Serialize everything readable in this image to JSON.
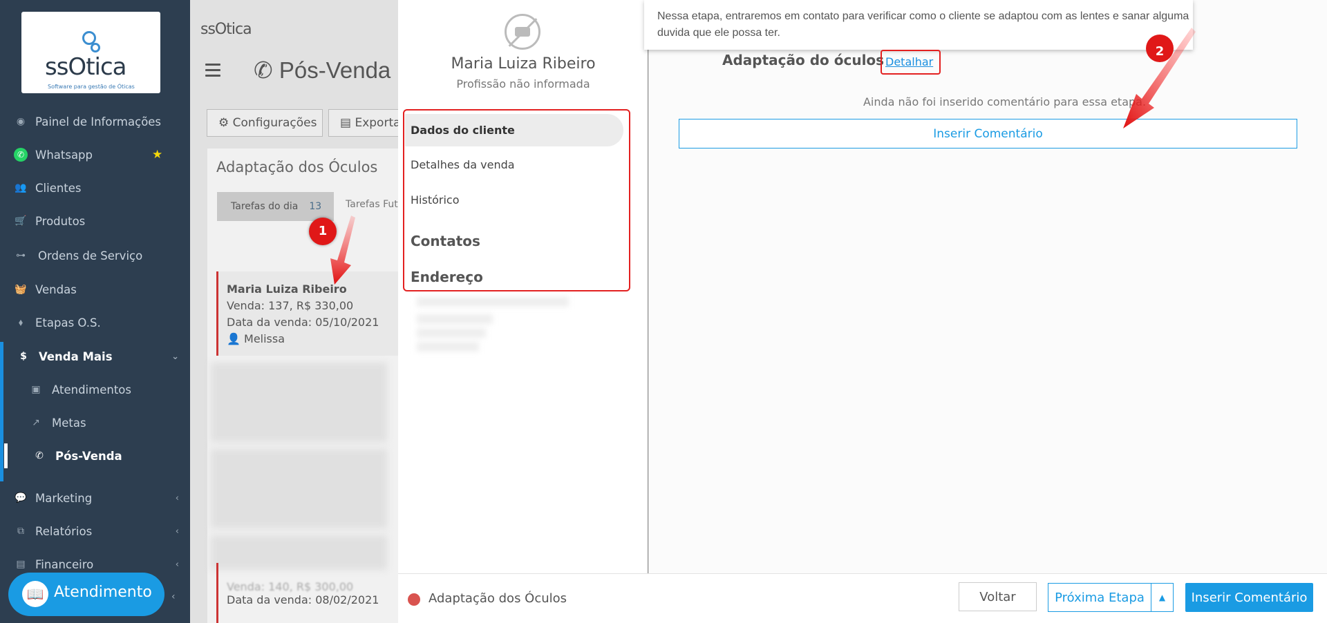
{
  "colors": {
    "sidebar": "#2d3e50",
    "accent": "#1a9be3",
    "annotation": "#e01818"
  },
  "brand": {
    "name": "ssOtica",
    "tagline": "Software para gestão de Óticas"
  },
  "sidebar": {
    "items": [
      {
        "icon": "dashboard-icon",
        "label": "Painel de Informações"
      },
      {
        "icon": "whatsapp-icon",
        "label": "Whatsapp",
        "extra": "★"
      },
      {
        "icon": "users-icon",
        "label": "Clientes"
      },
      {
        "icon": "cart-icon",
        "label": "Produtos"
      },
      {
        "icon": "glasses-icon",
        "label": "Ordens de Serviço"
      },
      {
        "icon": "basket-icon",
        "label": "Vendas"
      },
      {
        "icon": "tags-icon",
        "label": "Etapas O.S."
      },
      {
        "icon": "dollar-icon",
        "label": "Venda Mais"
      },
      {
        "icon": "clipboard-icon",
        "label": "Atendimentos"
      },
      {
        "icon": "chart-icon",
        "label": "Metas"
      },
      {
        "icon": "phone-icon",
        "label": "Pós-Venda"
      },
      {
        "icon": "comments-icon",
        "label": "Marketing"
      },
      {
        "icon": "copy-icon",
        "label": "Relatórios"
      },
      {
        "icon": "money-icon",
        "label": "Financeiro"
      }
    ],
    "atendimento": "Atendimento"
  },
  "background": {
    "page_title": "Pós-Venda",
    "buttons": {
      "config": "Configurações",
      "export": "Exportar"
    },
    "card_title": "Adaptação dos Óculos",
    "tabs": {
      "today": "Tarefas do dia",
      "today_count": "13",
      "future": "Tarefas Futu"
    },
    "task": {
      "name": "Maria Luiza Ribeiro",
      "sale": "Venda: 137, R$ 330,00",
      "date": "Data da venda: 05/10/2021",
      "seller": "Melissa"
    },
    "lower_task": {
      "sale": "Venda: 140, R$ 300,00",
      "date": "Data da venda: 08/02/2021"
    }
  },
  "markers": {
    "one": "1",
    "two": "2"
  },
  "modal": {
    "client_name": "Maria Luiza Ribeiro",
    "profession": "Profissão não informada",
    "menu": {
      "dados": "Dados do cliente",
      "detalhes": "Detalhes da venda",
      "historico": "Histórico",
      "contatos": "Contatos",
      "endereco": "Endereço"
    },
    "tooltip": "Nessa etapa, entraremos em contato para verificar como o cliente se adaptou com as lentes e sanar alguma duvida que ele possa ter.",
    "stage_title": "Adaptação do óculos",
    "detalhar": "Detalhar",
    "no_comment": "Ainda não foi inserido comentário para essa etapa.",
    "insert_comment": "Inserir Comentário",
    "footer": {
      "stage": "Adaptação dos Óculos",
      "back": "Voltar",
      "next": "Próxima Etapa",
      "insert": "Inserir Comentário"
    }
  }
}
